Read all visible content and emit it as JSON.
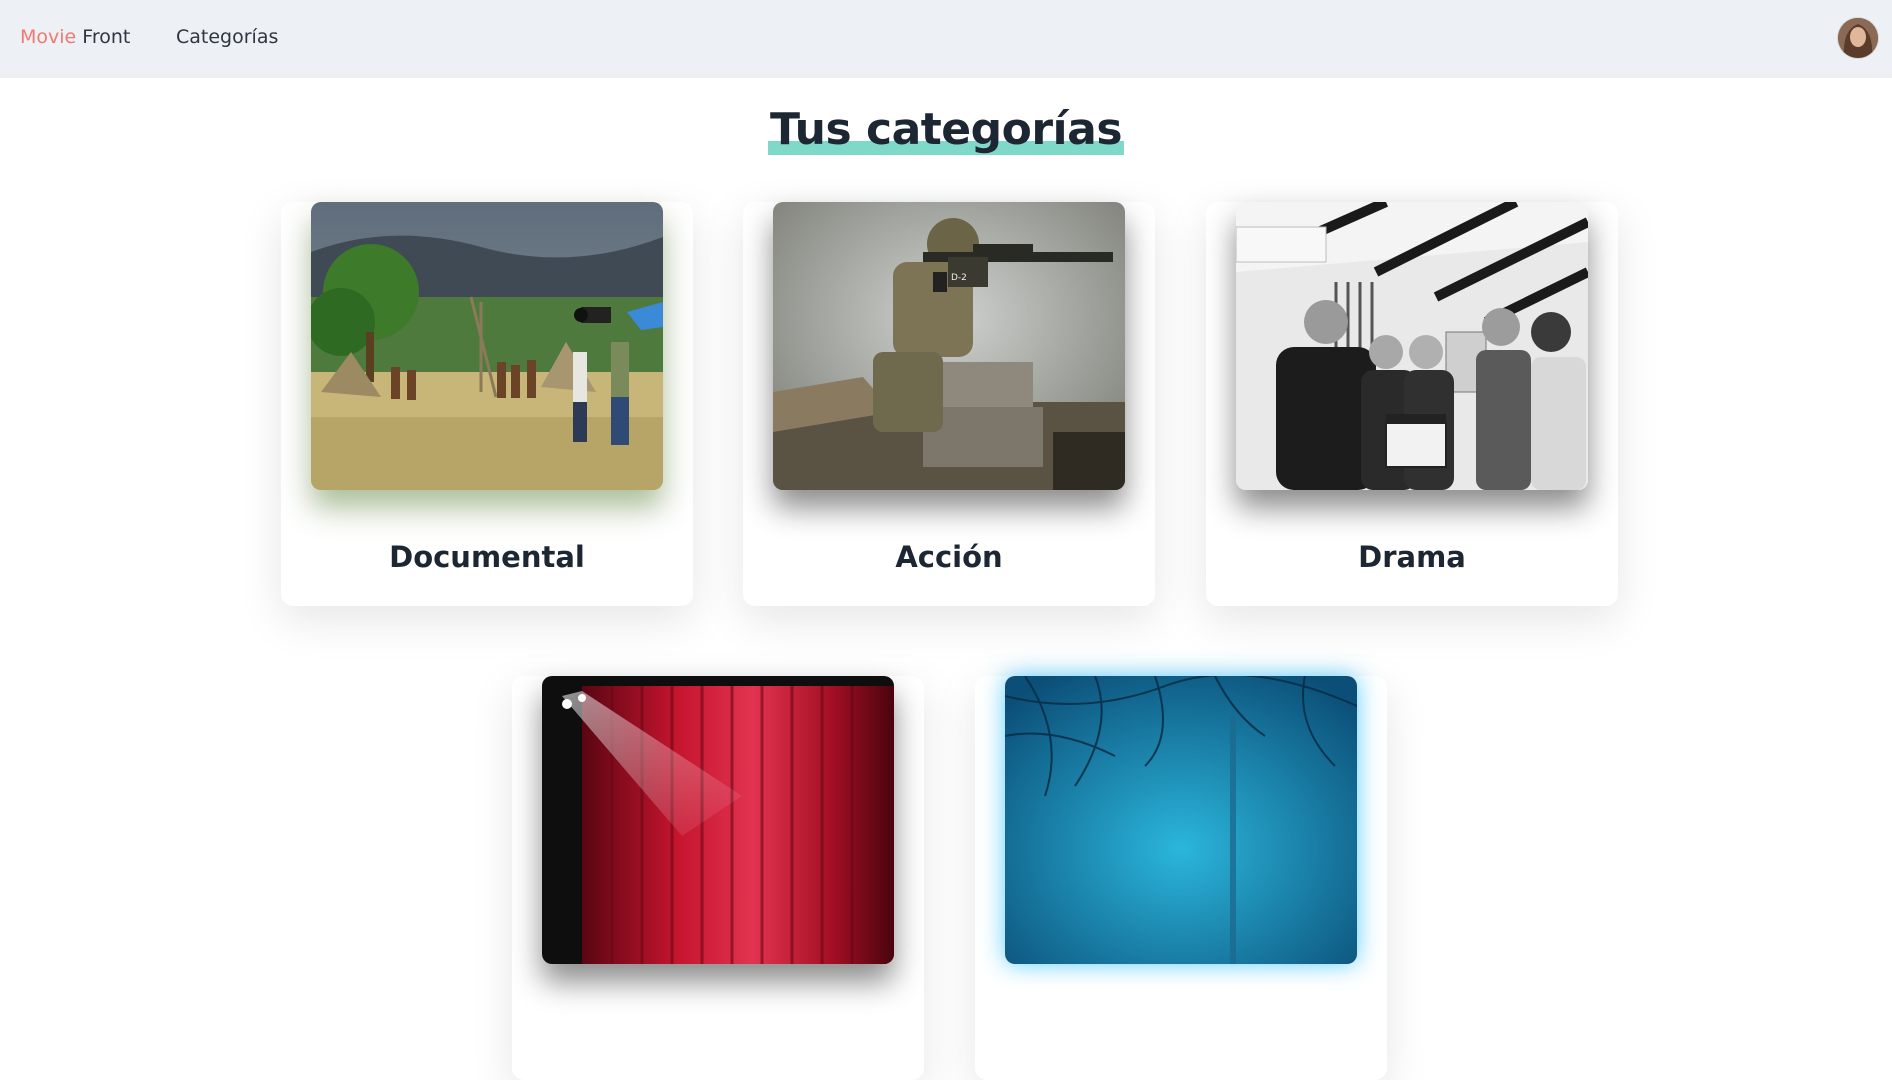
{
  "navbar": {
    "brand_part1": "Movie",
    "brand_part2": "Front",
    "categories_link": "Categorías",
    "avatar_icon": "user-avatar",
    "colors": {
      "background": "#edf1f5",
      "brand_accent": "#f07a72"
    }
  },
  "page": {
    "title": "Tus categorías",
    "title_highlight_color": "#7ed9cb"
  },
  "categories": [
    {
      "label": "Documental",
      "image": "documentary-film-crew-photo"
    },
    {
      "label": "Acción",
      "image": "soldier-with-rifle-photo"
    },
    {
      "label": "Drama",
      "image": "film-clapperboard-group-photo"
    },
    {
      "label": "",
      "image": "theater-red-curtain-photo"
    },
    {
      "label": "",
      "image": "blue-foggy-forest-photo"
    }
  ]
}
